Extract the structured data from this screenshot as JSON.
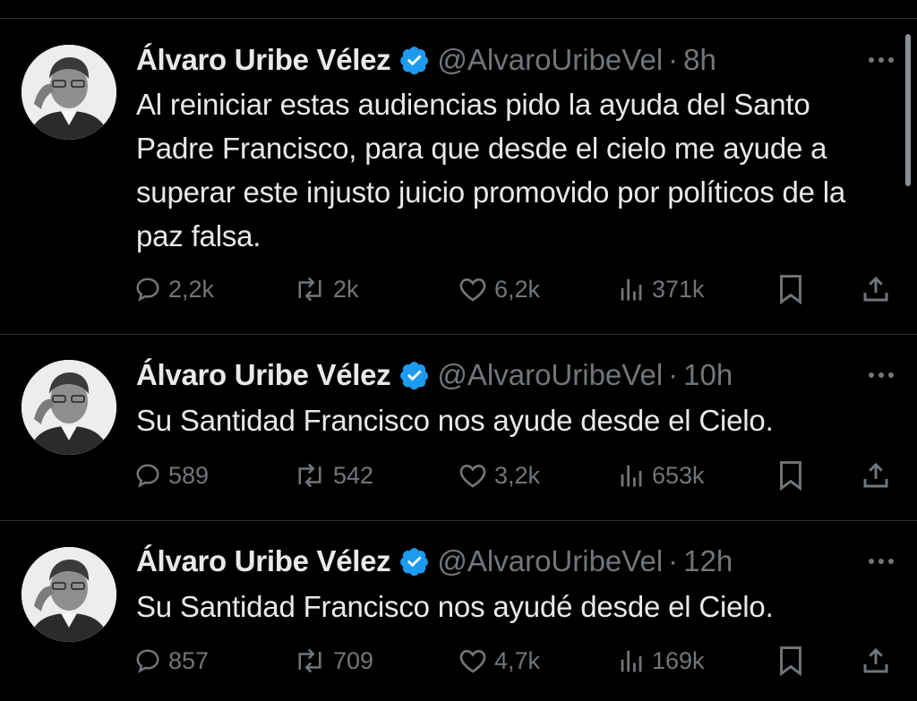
{
  "author": {
    "name": "Álvaro Uribe Vélez",
    "handle": "@AlvaroUribeVel",
    "verified_color": "#1d9bf0"
  },
  "separator": "·",
  "tweets": [
    {
      "time": "8h",
      "text": "Al reiniciar estas audiencias pido la ayuda del Santo Padre Francisco, para que desde el cielo me ayude a superar este injusto juicio promovido por políticos de la paz falsa.",
      "replies": "2,2k",
      "reposts": "2k",
      "likes": "6,2k",
      "views": "371k"
    },
    {
      "time": "10h",
      "text": "Su Santidad Francisco nos ayude desde el Cielo.",
      "replies": "589",
      "reposts": "542",
      "likes": "3,2k",
      "views": "653k"
    },
    {
      "time": "12h",
      "text": "Su Santidad Francisco nos ayudé desde el Cielo.",
      "replies": "857",
      "reposts": "709",
      "likes": "4,7k",
      "views": "169k"
    }
  ],
  "icons": {
    "reply": "reply-icon",
    "repost": "repost-icon",
    "like": "like-icon",
    "views": "views-icon",
    "bookmark": "bookmark-icon",
    "share": "share-icon",
    "more": "more-icon",
    "verified": "verified-badge-icon"
  },
  "colors": {
    "background": "#000000",
    "text": "#e7e9ea",
    "secondary": "#71767b",
    "divider": "#2f3336"
  }
}
